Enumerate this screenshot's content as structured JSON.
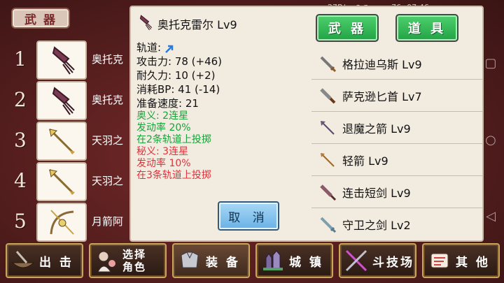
{
  "status_bar": {
    "speed": "27B/s",
    "time": "07:46",
    "battery": "76"
  },
  "weapon_list": {
    "header": "武 器",
    "items": [
      {
        "num": "1",
        "name": "奥托克",
        "icon": "squid-weapon-icon"
      },
      {
        "num": "2",
        "name": "奥托克",
        "icon": "squid-weapon-icon"
      },
      {
        "num": "3",
        "name": "天羽之",
        "icon": "arrow-icon"
      },
      {
        "num": "4",
        "name": "天羽之",
        "icon": "arrow-icon"
      },
      {
        "num": "5",
        "name": "月箭阿",
        "icon": "bow-icon"
      }
    ]
  },
  "detail": {
    "title": "奥托克雷尔 Lv9",
    "track_label": "轨道:",
    "stats": [
      "攻击力: 78 (+46)",
      "耐久力: 10 (+2)",
      "消耗BP: 41 (-14)",
      "准备速度: 21"
    ],
    "skill_green": [
      "奥义:  2连星",
      "发动率 20%",
      "在2条轨道上投掷"
    ],
    "skill_red": [
      "秘义:  3连星",
      "发动率 10%",
      "在3条轨道上投掷"
    ],
    "cancel": "取 消"
  },
  "tabs": {
    "weapons": "武 器",
    "items": "道 具"
  },
  "equip_list": [
    {
      "name": "格拉迪乌斯 Lv9",
      "icon": "sword-icon"
    },
    {
      "name": "萨克逊匕首 Lv7",
      "icon": "dagger-icon"
    },
    {
      "name": "退魔之箭 Lv9",
      "icon": "arrow-icon"
    },
    {
      "name": "轻箭 Lv9",
      "icon": "arrow-icon"
    },
    {
      "name": "连击短剑 Lv9",
      "icon": "short-sword-icon"
    },
    {
      "name": "守卫之剑 Lv2",
      "icon": "sword-icon"
    }
  ],
  "bottom_nav": [
    {
      "label": "出 击",
      "icon": "ship-icon"
    },
    {
      "label_1": "选择",
      "label_2": "角色",
      "icon": "character-icon"
    },
    {
      "label": "装 备",
      "icon": "armor-icon"
    },
    {
      "label": "城 镇",
      "icon": "castle-icon"
    },
    {
      "label": "斗技场",
      "icon": "crossed-swords-icon"
    },
    {
      "label": "其 他",
      "icon": "scroll-icon"
    }
  ],
  "colors": {
    "tab_green": "#21a346",
    "skill_green": "#18a23a",
    "skill_red": "#e0323a",
    "background": "#5b2020"
  }
}
